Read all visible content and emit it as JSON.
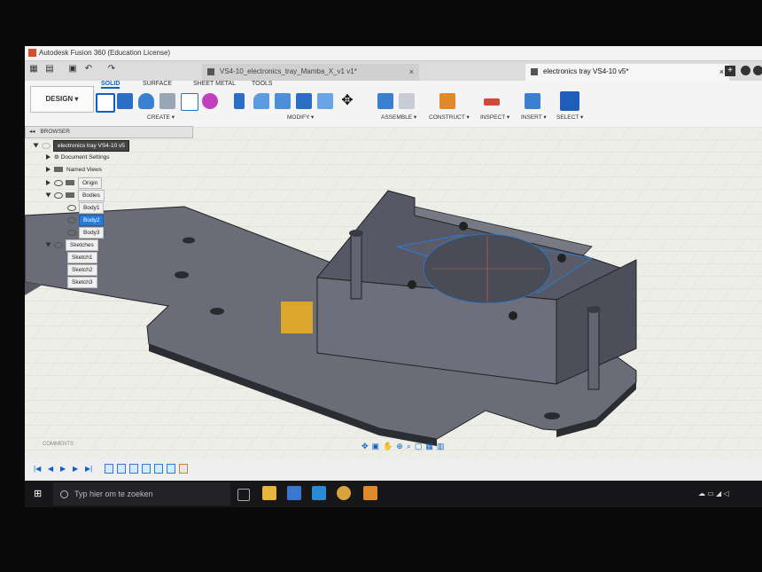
{
  "window": {
    "title": "Autodesk Fusion 360 (Education License)"
  },
  "tabs": [
    {
      "label": "VS4-10_electronics_tray_Mamba_X_v1 v1*",
      "close": "×"
    },
    {
      "label": "electronics tray VS4-10 v5*",
      "close": "×"
    }
  ],
  "toolbar": {
    "design_label": "DESIGN ▾",
    "workspace_tabs": [
      "SOLID",
      "SURFACE",
      "SHEET METAL",
      "TOOLS"
    ],
    "groups": {
      "create": "CREATE ▾",
      "modify": "MODIFY ▾",
      "assemble": "ASSEMBLE ▾",
      "construct": "CONSTRUCT ▾",
      "inspect": "INSPECT ▾",
      "insert": "INSERT ▾",
      "select": "SELECT ▾"
    }
  },
  "browser": {
    "title": "BROWSER",
    "root": "electronics tray VS4-10 v5",
    "items": {
      "document_settings": "Document Settings",
      "named_views": "Named Views",
      "origin": "Origin",
      "bodies": "Bodies",
      "body1": "Body1",
      "body2": "Body2",
      "body3": "Body3",
      "sketches": "Sketches",
      "sketch1": "Sketch1",
      "sketch2": "Sketch2",
      "sketch3": "Sketch3"
    }
  },
  "comments_label": "COMMENTS",
  "taskbar": {
    "search_placeholder": "Typ hier om te zoeken"
  },
  "colors": {
    "accent": "#1060c0",
    "selection": "#2a7bd6",
    "model_face": "#5f6170",
    "grid": "#e4e4dc"
  }
}
